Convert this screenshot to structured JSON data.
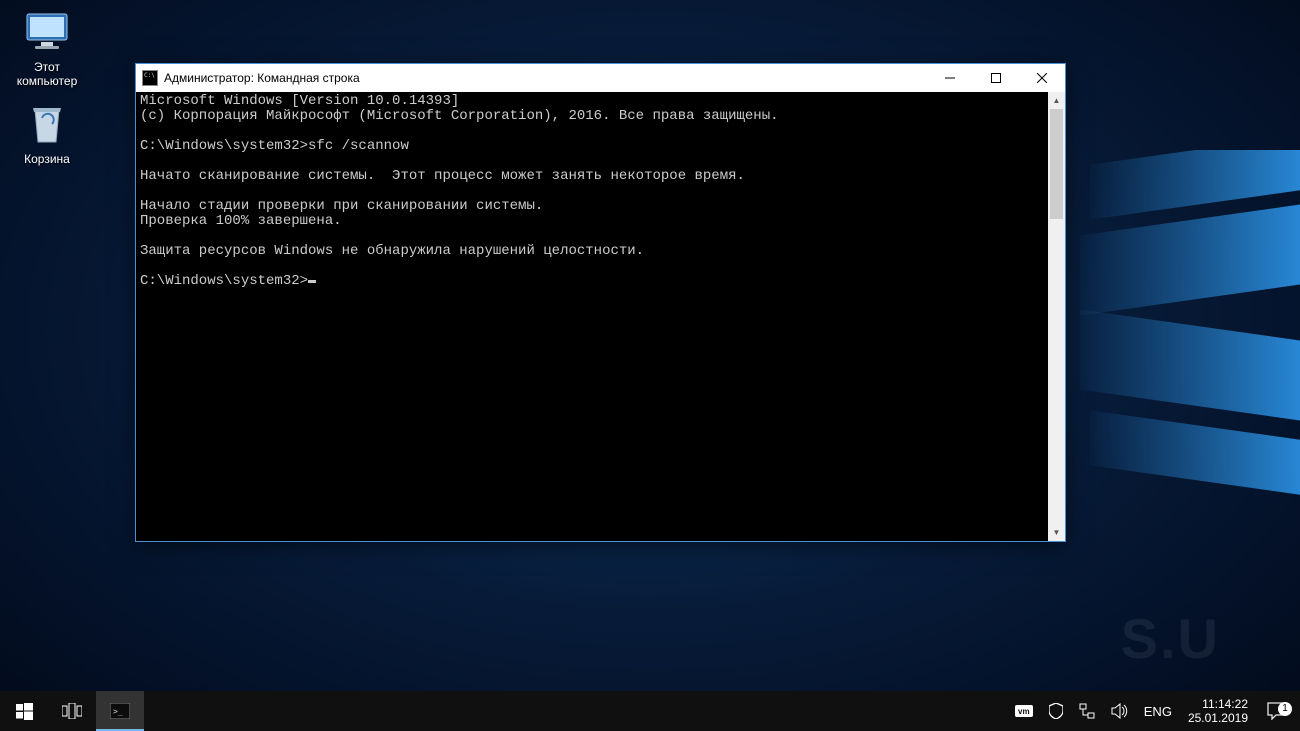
{
  "desktop": {
    "icons": [
      {
        "id": "thispc",
        "label": "Этот\nкомпьютер"
      },
      {
        "id": "bin",
        "label": "Корзина"
      }
    ]
  },
  "cmd_window": {
    "title_prefix": "Администратор: ",
    "title": "Командная строка",
    "lines": [
      "Microsoft Windows [Version 10.0.14393]",
      "(c) Корпорация Майкрософт (Microsoft Corporation), 2016. Все права защищены.",
      "",
      "C:\\Windows\\system32>sfc /scannow",
      "",
      "Начато сканирование системы.  Этот процесс может занять некоторое время.",
      "",
      "Начало стадии проверки при сканировании системы.",
      "Проверка 100% завершена.",
      "",
      "Защита ресурсов Windows не обнаружила нарушений целостности.",
      "",
      "C:\\Windows\\system32>"
    ]
  },
  "taskbar": {
    "lang": "ENG",
    "time": "11:14:22",
    "date": "25.01.2019",
    "notif_count": "1"
  },
  "watermark": "S.U"
}
